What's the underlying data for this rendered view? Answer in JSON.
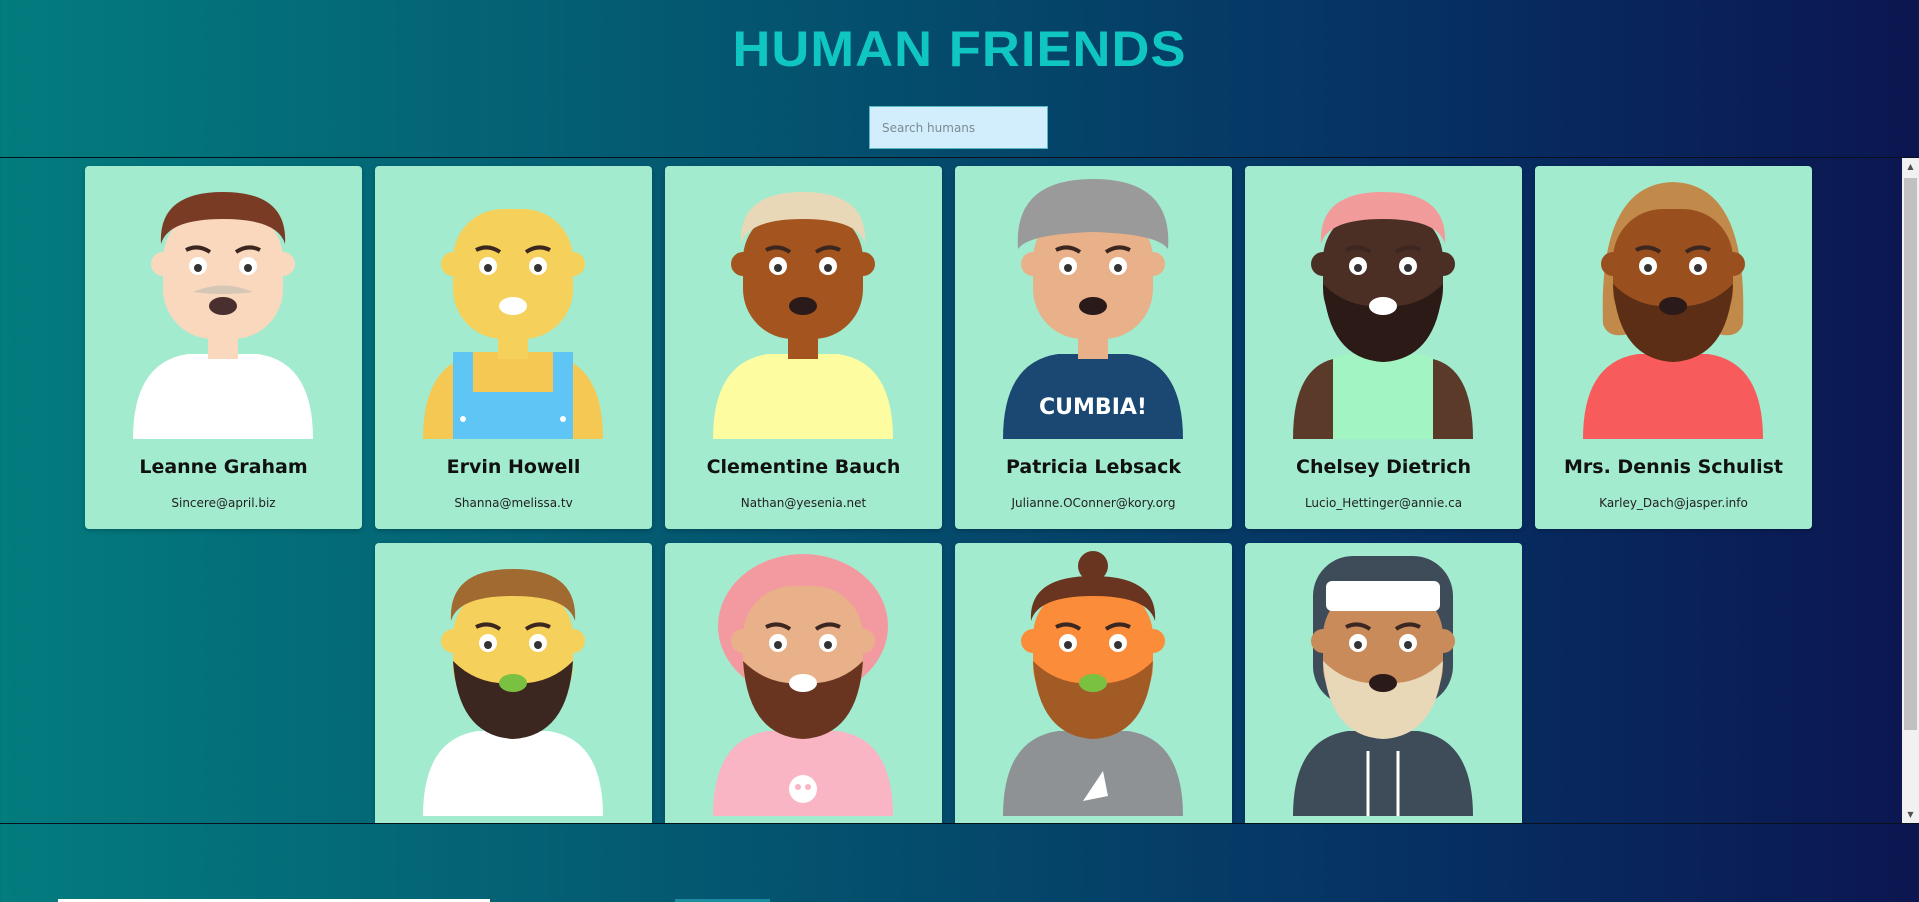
{
  "app": {
    "title": "HUMAN FRIENDS"
  },
  "search": {
    "placeholder": "Search humans",
    "value": ""
  },
  "cards": [
    {
      "name": "Leanne Graham",
      "email": "Sincere@april.biz",
      "avatar": "avatar-brown-hair-gray-mustache"
    },
    {
      "name": "Ervin Howell",
      "email": "Shanna@melissa.tv",
      "avatar": "avatar-bald-yellow-overalls"
    },
    {
      "name": "Clementine Bauch",
      "email": "Nathan@yesenia.net",
      "avatar": "avatar-blonde-hair-yellow-shirt"
    },
    {
      "name": "Patricia Lebsack",
      "email": "Julianne.OConner@kory.org",
      "avatar": "avatar-gray-turban-cumbia-shirt"
    },
    {
      "name": "Chelsey Dietrich",
      "email": "Lucio_Hettinger@annie.ca",
      "avatar": "avatar-pink-hair-beard-green-tank"
    },
    {
      "name": "Mrs. Dennis Schulist",
      "email": "Karley_Dach@jasper.info",
      "avatar": "avatar-long-hair-beard-red-shirt"
    },
    {
      "name": "",
      "email": "",
      "avatar": "avatar-yellow-face-dark-beard"
    },
    {
      "name": "",
      "email": "",
      "avatar": "avatar-pink-curly-hair-skull-shirt"
    },
    {
      "name": "",
      "email": "",
      "avatar": "avatar-man-bun-pizza-shirt"
    },
    {
      "name": "",
      "email": "",
      "avatar": "avatar-winter-hat-white-beard"
    }
  ],
  "avatar_shirt_text": "CUMBIA!",
  "colors": {
    "card_background": "#a2ebcf",
    "title": "#0fc6c3",
    "search_background": "#d2eefd"
  },
  "scrollbar": {
    "up_icon": "scroll-up-arrow-icon",
    "down_icon": "scroll-down-arrow-icon"
  }
}
